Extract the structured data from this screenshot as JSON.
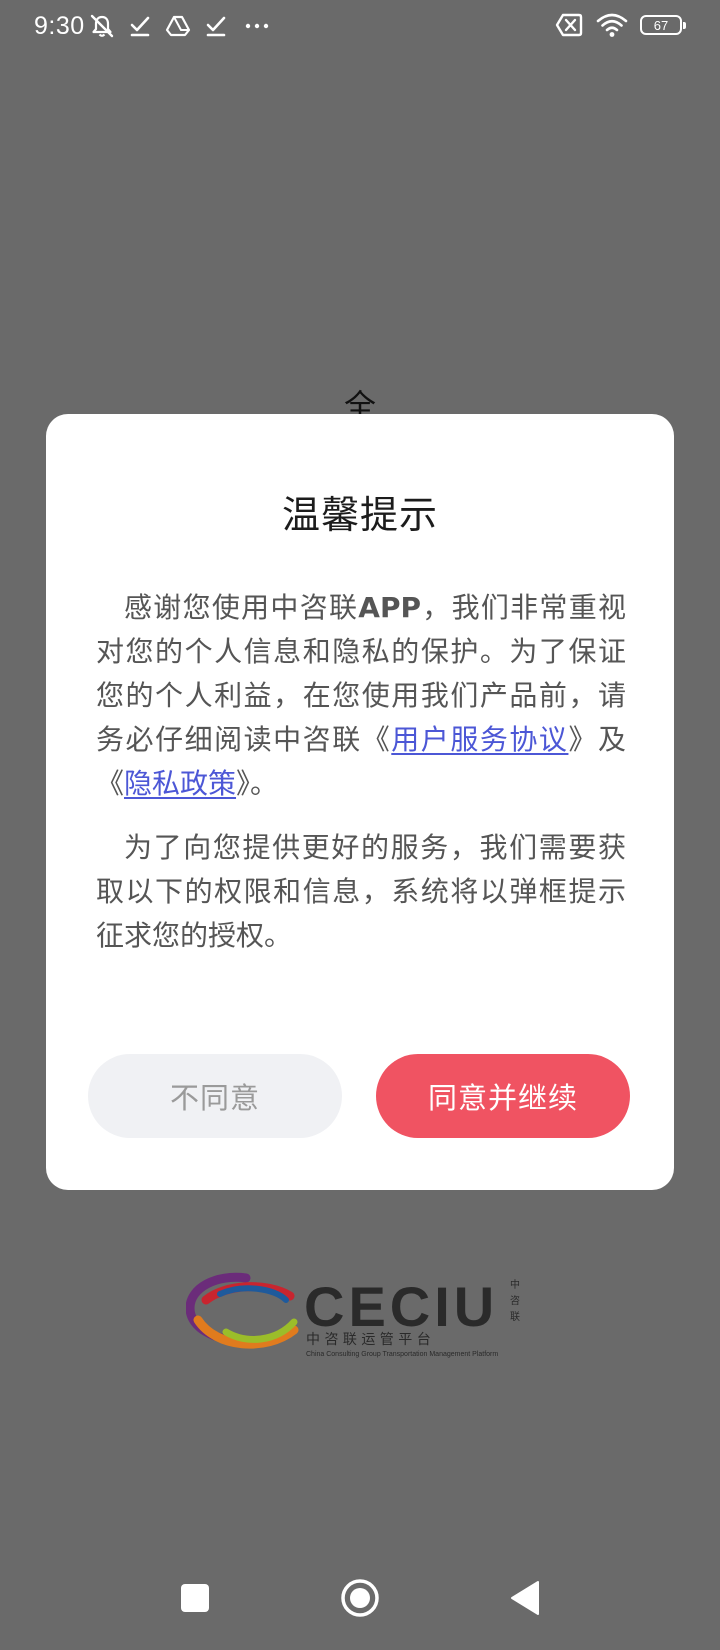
{
  "status_bar": {
    "time": "9:30",
    "left_icons": [
      "notifications-off-icon",
      "check-icon",
      "drive-icon",
      "check-icon",
      "more-dots-icon"
    ],
    "right_icons": [
      "sim-off-icon",
      "wifi-icon",
      "battery-icon"
    ],
    "battery_level": "67"
  },
  "background": {
    "title_partial": "全"
  },
  "dialog": {
    "title": "温馨提示",
    "paragraph1": {
      "text_before_app": "感谢您使用中咨联",
      "app_name": "APP",
      "text_after_app": "，我们非常重视对您的个人信息和隐私的保护。为了保证您的个人利益，在您使用我们产品前，请务必仔细阅读中咨联《",
      "user_agreement_link": "用户服务协议",
      "text_between": "》及《",
      "privacy_policy_link": "隐私政策",
      "text_end": "》。"
    },
    "paragraph2": "为了向您提供更好的服务，我们需要获取以下的权限和信息，系统将以弹框提示征求您的授权。",
    "disagree_label": "不同意",
    "agree_label": "同意并继续"
  },
  "logo": {
    "brand": "CECIU",
    "cn_vertical": "中咨联",
    "cn_name": "中 咨 联 运 管 平 台",
    "en_name": "China Consulting Group Transportation Management Platform"
  },
  "nav_bar": {
    "buttons": [
      "recents-icon",
      "home-icon",
      "back-icon"
    ]
  },
  "colors": {
    "overlay_background": "#6a6a6a",
    "agree_button": "#f05362",
    "disagree_button": "#f0f1f4",
    "link": "#4c57d6"
  }
}
